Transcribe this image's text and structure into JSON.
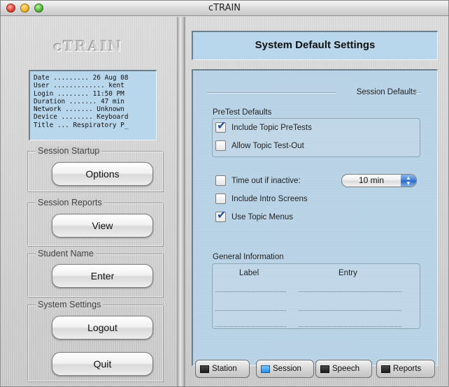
{
  "window": {
    "title": "cTRAIN"
  },
  "left": {
    "logo": "cTRAIN",
    "info_lines": [
      "Date ......... 26 Aug 08",
      "User ............. kent",
      "Login ........ 11:50 PM",
      "Duration ....... 47 min",
      "Network ....... Unknown",
      "Device ........ Keyboard",
      "Title ... Respiratory P_"
    ],
    "groups": [
      {
        "label": "Session Startup",
        "buttons": [
          "Options"
        ]
      },
      {
        "label": "Session Reports",
        "buttons": [
          "View"
        ]
      },
      {
        "label": "Student Name",
        "buttons": [
          "Enter"
        ]
      },
      {
        "label": "System Settings",
        "buttons": [
          "Logout",
          "Quit"
        ]
      }
    ]
  },
  "right": {
    "header": "System Default Settings",
    "section_title": "Session Defaults",
    "pretest": {
      "label": "PreTest Defaults",
      "include_topic_pretests": {
        "label": "Include Topic PreTests",
        "checked": true
      },
      "allow_topic_testout": {
        "label": "Allow Topic Test-Out",
        "checked": false
      }
    },
    "options": {
      "timeout": {
        "label": "Time out if inactive:",
        "checked": false,
        "value": "10 min"
      },
      "intro_screens": {
        "label": "Include Intro Screens",
        "checked": false
      },
      "topic_menus": {
        "label": "Use Topic Menus",
        "checked": true
      }
    },
    "general": {
      "label": "General Information",
      "col_label": "Label",
      "col_entry": "Entry"
    }
  },
  "tabs": [
    {
      "label": "Station",
      "active": false
    },
    {
      "label": "Session",
      "active": true
    },
    {
      "label": "Speech",
      "active": false
    },
    {
      "label": "Reports",
      "active": false
    }
  ],
  "colors": {
    "panel_blue": "#b9d7ec",
    "tab_active_indicator": "#1e8ee8",
    "check_color": "#1f4fa0"
  }
}
